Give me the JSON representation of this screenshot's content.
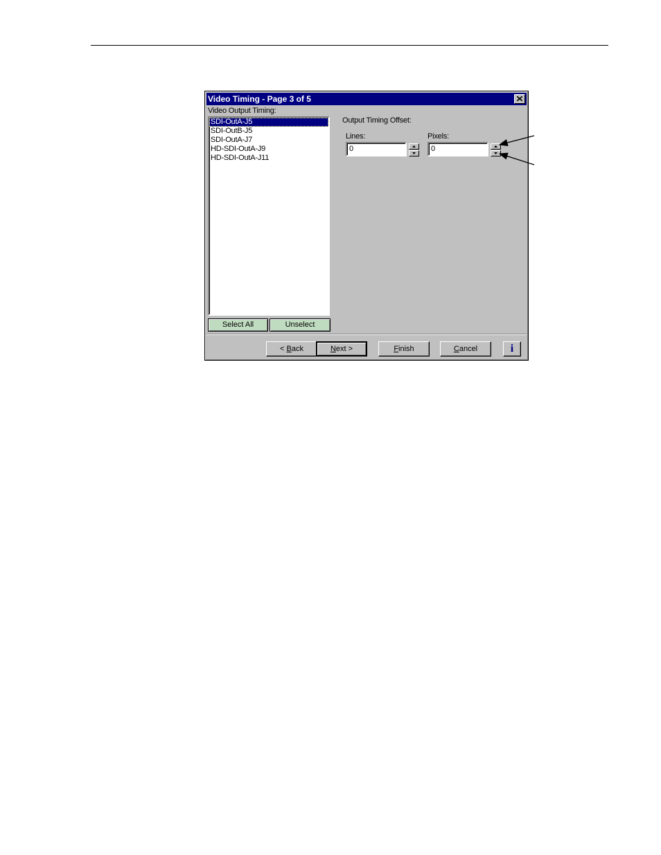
{
  "dialog": {
    "title": "Video Timing - Page 3 of 5",
    "close_icon": "close-icon"
  },
  "left_panel": {
    "label": "Video Output Timing:",
    "items": [
      {
        "label": "SDI-OutA-J5",
        "selected": true
      },
      {
        "label": "SDI-OutB-J5",
        "selected": false
      },
      {
        "label": "SDI-OutA-J7",
        "selected": false
      },
      {
        "label": "HD-SDI-OutA-J9",
        "selected": false
      },
      {
        "label": "HD-SDI-OutA-J11",
        "selected": false
      }
    ],
    "select_all_label": "Select All",
    "unselect_label": "Unselect",
    "button_color": "#c0dcc0"
  },
  "offset": {
    "group_label": "Output Timing Offset:",
    "lines_label": "Lines:",
    "lines_value": "0",
    "pixels_label": "Pixels:",
    "pixels_value": "0"
  },
  "footer": {
    "back_mnemonic": "B",
    "back_rest": "ack",
    "next_mnemonic": "N",
    "next_rest": "ext >",
    "finish_mnemonic": "F",
    "finish_rest": "inish",
    "cancel_mnemonic": "C",
    "cancel_rest": "ancel",
    "info_label": "i"
  },
  "colors": {
    "titlebar": "#000080",
    "face": "#c0c0c0",
    "selection": "#000080"
  }
}
